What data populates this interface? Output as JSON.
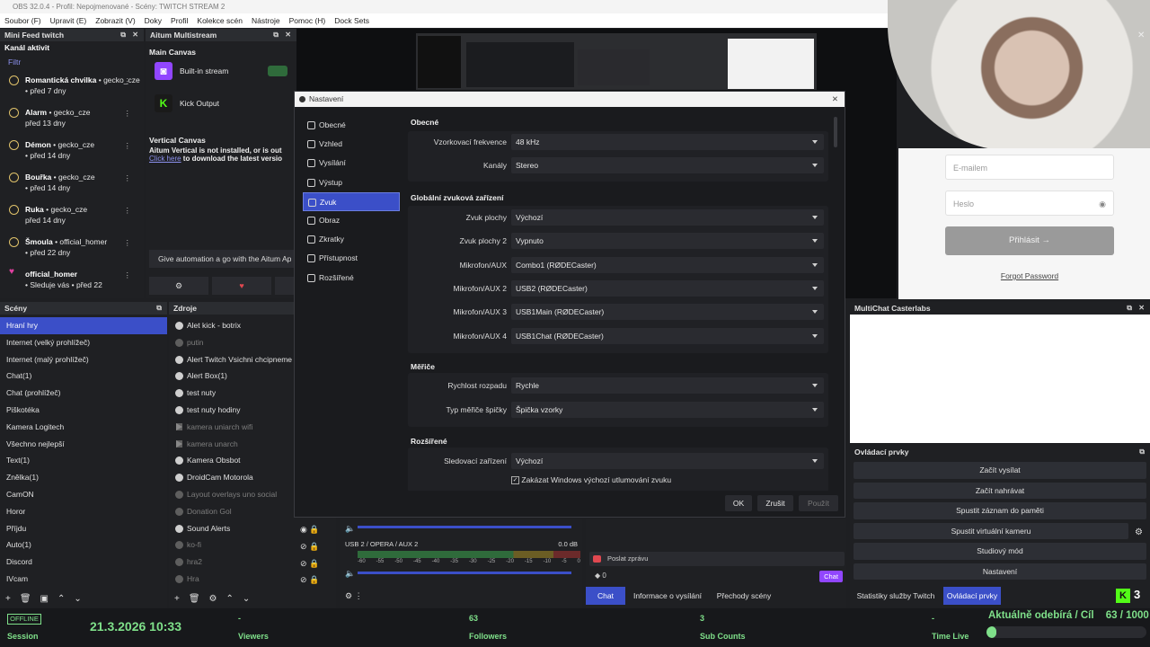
{
  "window": {
    "title": "OBS 32.0.4 - Profil: Nepojmenované - Scény: TWITCH STREAM 2"
  },
  "menu": [
    "Soubor (F)",
    "Upravit (E)",
    "Zobrazit (V)",
    "Doky",
    "Profil",
    "Kolekce scén",
    "Nástroje",
    "Pomoc (H)",
    "Dock Sets"
  ],
  "minifeed": {
    "title": "Mini Feed twitch",
    "channel": "Kanál aktivit",
    "filter": "Filtr",
    "items": [
      {
        "name": "Romantická chvilka",
        "sep": " • ",
        "user": "gecko_cze",
        "time": "• před 7 dny"
      },
      {
        "name": "Alarm",
        "sep": " • ",
        "user": "gecko_cze",
        "time": "před 13 dny"
      },
      {
        "name": "Démon",
        "sep": " • ",
        "user": "gecko_cze",
        "time": "• před 14 dny"
      },
      {
        "name": "Bouřka",
        "sep": " • ",
        "user": "gecko_cze",
        "time": "• před 14 dny"
      },
      {
        "name": "Ruka",
        "sep": " • ",
        "user": "gecko_cze",
        "time": "před 14 dny"
      },
      {
        "name": "Šmoula",
        "sep": " • ",
        "user": "official_homer",
        "time": "• před 22 dny"
      },
      {
        "name": "official_homer",
        "sep": "",
        "user": "",
        "time": "• Sleduje vás • před 22"
      }
    ]
  },
  "altum": {
    "title": "Aitum Multistream",
    "main_canvas": "Main Canvas",
    "builtin": "Built-in stream",
    "kick": "Kick Output",
    "vertical_canvas": "Vertical Canvas",
    "vertical_msg": "Aitum Vertical is not installed, or is out",
    "click_here": "Click here",
    "download_msg": " to download the latest versio",
    "automation": "Give automation a go with the Aitum Ap"
  },
  "login": {
    "email_placeholder": "E-mailem",
    "password_placeholder": "Heslo",
    "login_button": "Přihlásit →",
    "forgot": "Forgot Password"
  },
  "scenes": {
    "title": "Scény",
    "items": [
      "Hraní hry",
      "Internet (velký prohlížeč)",
      "Internet (malý prohlížeč)",
      "Chat(1)",
      "Chat (prohlížeč)",
      "Piškotéka",
      "Kamera Logitech",
      "Všechno nejlepší",
      "Text(1)",
      "Znělka(1)",
      "CamON",
      "Horor",
      "Příjdu",
      "Auto(1)",
      "Discord",
      "IVcam"
    ]
  },
  "sources": {
    "title": "Zdroje",
    "items": [
      {
        "label": "Alet kick - botrix",
        "dim": false,
        "group": false
      },
      {
        "label": "putin",
        "dim": true,
        "group": false
      },
      {
        "label": "Alert Twitch Vsichni chcipneme",
        "dim": false,
        "group": false
      },
      {
        "label": "Alert Box(1)",
        "dim": false,
        "group": false
      },
      {
        "label": "test nuty",
        "dim": false,
        "group": false
      },
      {
        "label": "test nuty hodiny",
        "dim": false,
        "group": false
      },
      {
        "label": "kamera uniarch wifi",
        "dim": true,
        "group": true
      },
      {
        "label": "kamera unarch",
        "dim": true,
        "group": true
      },
      {
        "label": "Kamera Obsbot",
        "dim": false,
        "group": false
      },
      {
        "label": "DroidCam Motorola",
        "dim": false,
        "group": false
      },
      {
        "label": "Layout overlays uno social",
        "dim": true,
        "group": false
      },
      {
        "label": "Donation Gol",
        "dim": true,
        "group": false
      },
      {
        "label": "Sound Alerts",
        "dim": false,
        "group": false
      },
      {
        "label": "ko-fi",
        "dim": true,
        "group": false
      },
      {
        "label": "hra2",
        "dim": true,
        "group": false
      },
      {
        "label": "Hra",
        "dim": true,
        "group": false
      }
    ]
  },
  "settings": {
    "title": "Nastavení",
    "nav": [
      "Obecné",
      "Vzhled",
      "Vysílání",
      "Výstup",
      "Zvuk",
      "Obraz",
      "Zkratky",
      "Přístupnost",
      "Rozšířené"
    ],
    "selected_nav": "Zvuk",
    "general_hdr": "Obecné",
    "sample_rate_label": "Vzorkovací frekvence",
    "sample_rate": "48 kHz",
    "channels_label": "Kanály",
    "channels": "Stereo",
    "global_hdr": "Globální zvuková zařízení",
    "devices": [
      {
        "label": "Zvuk plochy",
        "value": "Výchozí"
      },
      {
        "label": "Zvuk plochy 2",
        "value": "Vypnuto"
      },
      {
        "label": "Mikrofon/AUX",
        "value": "Combo1 (RØDECaster)"
      },
      {
        "label": "Mikrofon/AUX 2",
        "value": "USB2 (RØDECaster)"
      },
      {
        "label": "Mikrofon/AUX 3",
        "value": "USB1Main (RØDECaster)"
      },
      {
        "label": "Mikrofon/AUX 4",
        "value": "USB1Chat (RØDECaster)"
      }
    ],
    "meters_hdr": "Měřiče",
    "decay_label": "Rychlost rozpadu",
    "decay": "Rychle",
    "peak_label": "Typ měřiče špičky",
    "peak": "Špička vzorky",
    "advanced_hdr": "Rozšířené",
    "monitor_label": "Sledovací zařízení",
    "monitor": "Výchozí",
    "ducking": "Zakázat Windows výchozí utlumování zvuku",
    "ok": "OK",
    "cancel": "Zrušit",
    "apply": "Použít"
  },
  "mixer": {
    "track_label": "USB 2 / OPERA / AUX 2",
    "db": "0.0 dB",
    "ticks": [
      "-60",
      "-55",
      "-50",
      "-45",
      "-40",
      "-35",
      "-30",
      "-25",
      "-20",
      "-15",
      "-10",
      "-5",
      "0"
    ]
  },
  "chat": {
    "placeholder": "Poslat zprávu",
    "count": "0",
    "chat_button": "Chat"
  },
  "bottom_tabs": [
    "Chat",
    "Informace o vysílání",
    "Přechody scény"
  ],
  "multichat": {
    "title": "MultiChat Casterlabs"
  },
  "controls": {
    "title": "Ovládací prvky",
    "buttons": [
      "Začít vysílat",
      "Začít nahrávat",
      "Spustit záznam do paměti",
      "Spustit virtuální kameru",
      "Studiový mód",
      "Nastavení"
    ]
  },
  "right_tabs": [
    "Statistiky služby Twitch",
    "Ovládací prvky"
  ],
  "kick_count": "3",
  "stats": {
    "offline": "OFFLINE",
    "session": "Session",
    "datetime": "21.3.2026 10:33",
    "viewers_val": "-",
    "viewers": "Viewers",
    "followers_val": "63",
    "followers": "Followers",
    "subs_val": "3",
    "subs": "Sub Counts",
    "time_val": "-",
    "time": "Time Live",
    "goal": "Aktuálně odebírá / Cíl",
    "goal_val": "63 / 1000",
    "goal_progress": 0.063
  },
  "colors": {
    "accent": "#3b4fc8",
    "green": "#7fe08a",
    "twitch": "#9146ff",
    "kick": "#53fc18"
  }
}
